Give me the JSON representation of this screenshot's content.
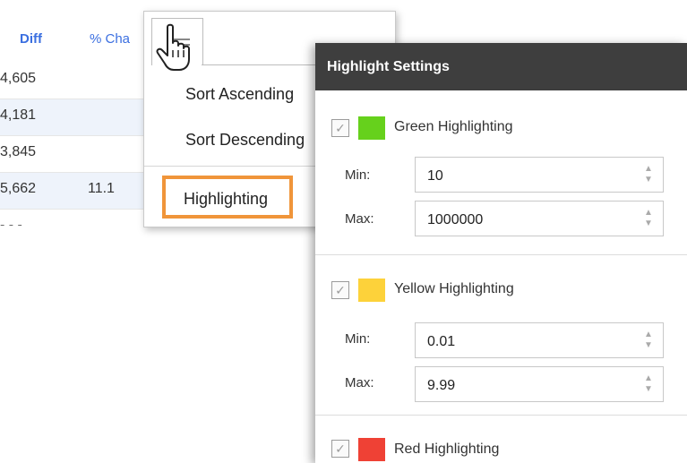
{
  "grid": {
    "headers": {
      "diff": "Diff",
      "pct": "% Cha"
    },
    "rows": [
      {
        "diff": "4,605",
        "pct": ""
      },
      {
        "diff": "4,181",
        "pct": ""
      },
      {
        "diff": "3,845",
        "pct": ""
      },
      {
        "diff": "5,662",
        "pct": "11.1"
      },
      {
        "diff": "- - -",
        "pct": ""
      }
    ]
  },
  "column_menu": {
    "items": [
      "Sort Ascending",
      "Sort Descending",
      "Highlighting"
    ]
  },
  "highlight_settings": {
    "title": "Highlight Settings",
    "sections": [
      {
        "label": "Green Highlighting",
        "color": "#66d11c",
        "checked": true,
        "min": "10",
        "max": "1000000"
      },
      {
        "label": "Yellow Highlighting",
        "color": "#fdd23a",
        "checked": true,
        "min": "0.01",
        "max": "9.99"
      },
      {
        "label": "Red Highlighting",
        "color": "#ef4135",
        "checked": true
      }
    ],
    "min_label": "Min:",
    "max_label": "Max:"
  }
}
